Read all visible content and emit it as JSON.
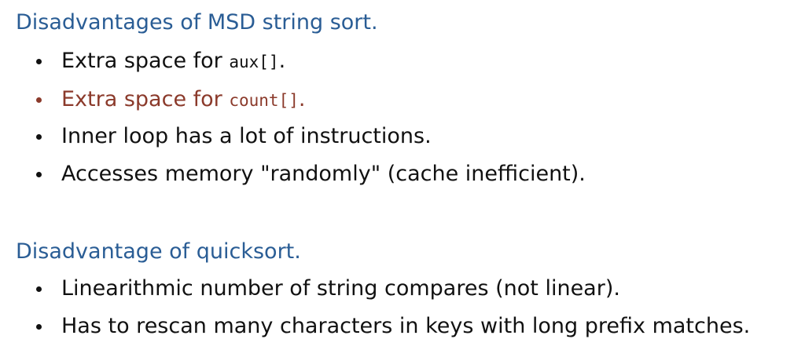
{
  "section1": {
    "heading": "Disadvantages of MSD string sort.",
    "items": [
      {
        "prefix": "Extra space for ",
        "code": "aux[]",
        "suffix": "."
      },
      {
        "prefix": "Extra space for ",
        "code": "count[]",
        "suffix": "."
      },
      {
        "text": "Inner loop has a lot of instructions."
      },
      {
        "text": "Accesses memory \"randomly\" (cache inefficient)."
      }
    ]
  },
  "section2": {
    "heading": "Disadvantage of quicksort.",
    "items": [
      {
        "text": "Linearithmic number of string compares (not linear)."
      },
      {
        "text": "Has to rescan many characters in keys with long prefix matches."
      }
    ]
  },
  "colors": {
    "heading": "#2a5d95",
    "body_text": "#111111",
    "highlight": "#8b3a2b"
  }
}
